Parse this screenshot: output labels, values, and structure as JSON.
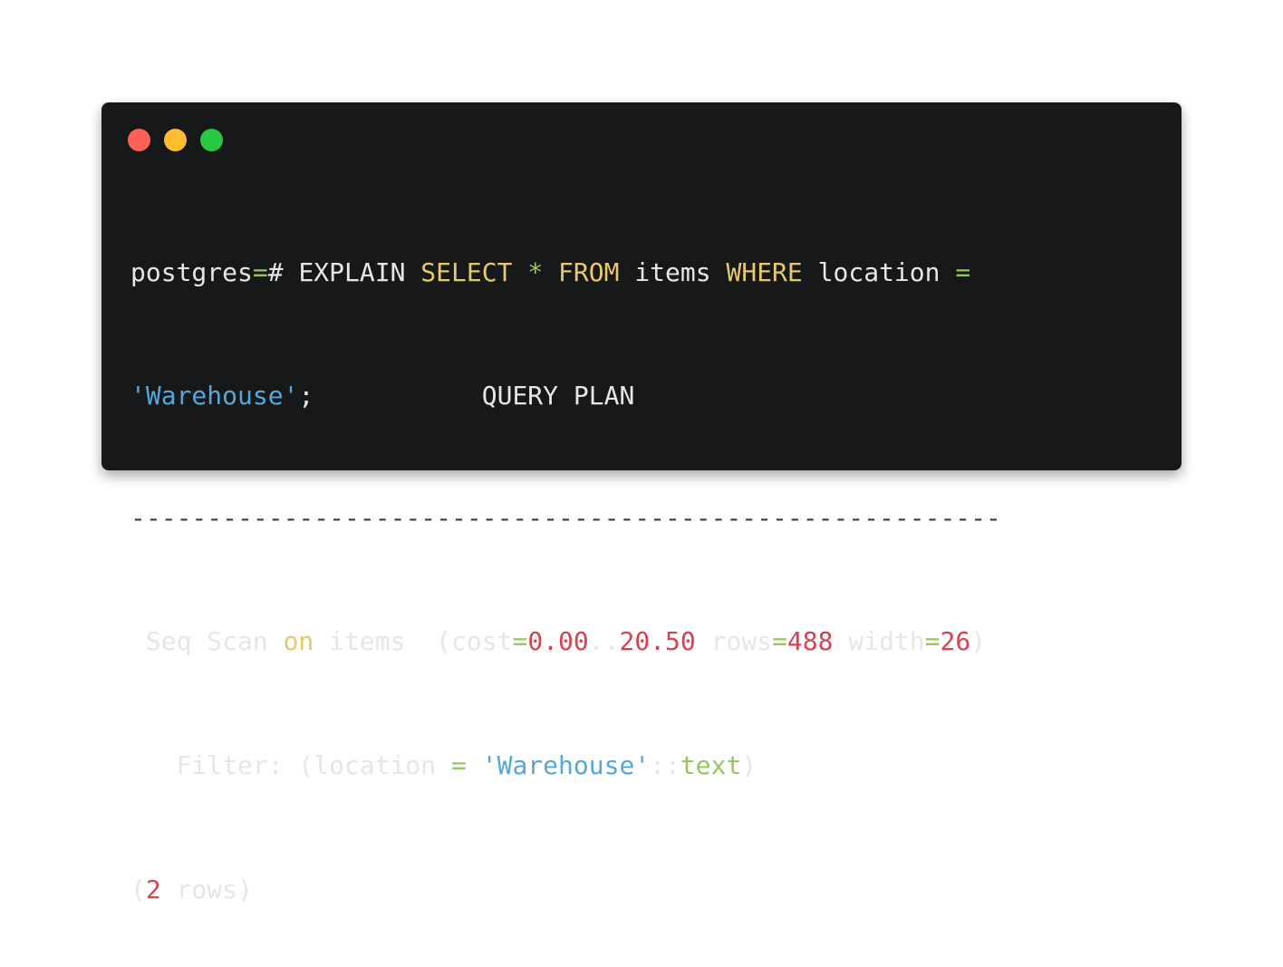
{
  "colors": {
    "background": "#17181a",
    "text": "#e6e6e6",
    "keyword": "#e6c86e",
    "operator": "#97c65c",
    "string": "#54a8d9",
    "number": "#d9414f",
    "type": "#97c65c",
    "separator": "#3c4448",
    "close_dot": "#fe5f57",
    "minimize_dot": "#febc2e",
    "zoom_dot": "#28c840"
  },
  "window_controls": {
    "close_icon": "close-dot-icon",
    "minimize_icon": "minimize-dot-icon",
    "zoom_icon": "zoom-dot-icon"
  },
  "line1": {
    "prompt": "postgres",
    "prompt_eq": "=",
    "prompt_hash": "# ",
    "explain": "EXPLAIN ",
    "select": "SELECT",
    "sp1": " ",
    "star": "*",
    "sp2": " ",
    "from": "FROM",
    "items": " items ",
    "where": "WHERE",
    "location": " location ",
    "eq": "="
  },
  "line2": {
    "string": "'Warehouse'",
    "rest": ";           QUERY PLAN"
  },
  "separator": "---------------------------------------------------------",
  "line3": {
    "seq_scan": " Seq Scan ",
    "on": "on",
    "items_cost": " items  (cost",
    "eq1": "=",
    "cost_start": "0.00",
    "dots": "..",
    "cost_end": "20.50",
    "rows_label": " rows",
    "eq2": "=",
    "rows": "488",
    "width_label": " width",
    "eq3": "=",
    "width": "26",
    "close": ")"
  },
  "line4": {
    "filter": "   Filter: (location ",
    "eq": "=",
    "sp": " ",
    "string": "'Warehouse'",
    "cast": "::",
    "type": "text",
    "close": ")"
  },
  "line5": {
    "open": "(",
    "count": "2",
    "rest": " rows)"
  }
}
